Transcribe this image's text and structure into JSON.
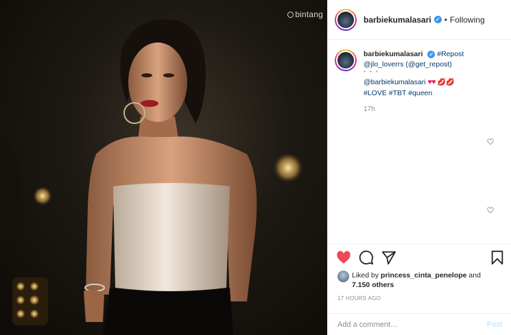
{
  "photo": {
    "watermark": "bintang"
  },
  "header": {
    "username": "barbiekumalasari",
    "separator": "•",
    "follow_status": "Following"
  },
  "caption": {
    "username": "barbiekumalasari",
    "hashtag_repost": "#Repost",
    "repost_credit": "@jlo_loverrs (@get_repost)",
    "dots": "• • •",
    "mention": "@barbiekumalasari",
    "emoji_hearts": "♥♥",
    "emoji_lips": "💋💋",
    "hashtags": "#LOVE #TBT #queen",
    "time": "17h"
  },
  "likes": {
    "prefix": "Liked by",
    "liker": "princess_cinta_penelope",
    "conjunction": "and",
    "count": "7.150 others"
  },
  "timestamp": "17 HOURS AGO",
  "comment_box": {
    "placeholder": "Add a comment…",
    "post_label": "Post"
  },
  "colors": {
    "like_red": "#ed4956",
    "link_blue": "#00376b",
    "verified_blue": "#3897f0"
  }
}
